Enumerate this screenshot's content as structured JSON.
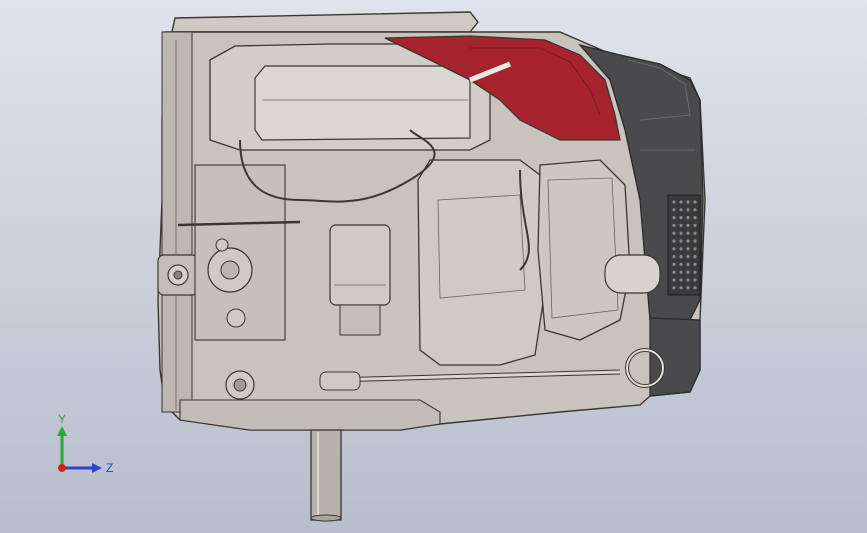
{
  "viewport": {
    "background_top": "#dfe3ec",
    "background_bottom": "#b7bdca"
  },
  "model": {
    "body_color": "#c9c3bd",
    "edge_color": "#3a3633",
    "cover_accent_color": "#a8242c",
    "dark_cover_color": "#4a4a4c",
    "shaft_color": "#b8b2ac"
  },
  "triad": {
    "y_label": "Y",
    "z_label": "Z",
    "y_color": "#2fa83a",
    "z_color": "#2a46c8",
    "x_color": "#cc2222"
  }
}
